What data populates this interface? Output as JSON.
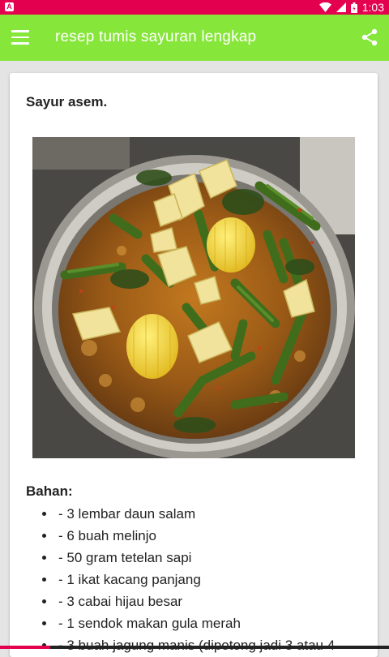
{
  "status_bar": {
    "notification_badge": "A",
    "time": "1:03",
    "icons": [
      "wifi-icon",
      "cell-signal-icon",
      "battery-icon"
    ],
    "color": "#e3004f"
  },
  "app_bar": {
    "title": "resep tumis sayuran lengkap",
    "color": "#86e63a",
    "menu_icon": "hamburger-menu-icon",
    "share_icon": "share-icon"
  },
  "recipe": {
    "title": "Sayur asem.",
    "image": "sayur-asem-photo",
    "ingredients_heading": "Bahan:",
    "ingredients": [
      "- 3 lembar daun salam",
      "- 6 buah melinjo",
      "- 50 gram tetelan sapi",
      "- 1 ikat kacang panjang",
      "- 3 cabai hijau besar",
      "- 1 sendok makan gula merah",
      "- 3 buah jagung manis (dipotong jadi 3 atau 4"
    ]
  }
}
